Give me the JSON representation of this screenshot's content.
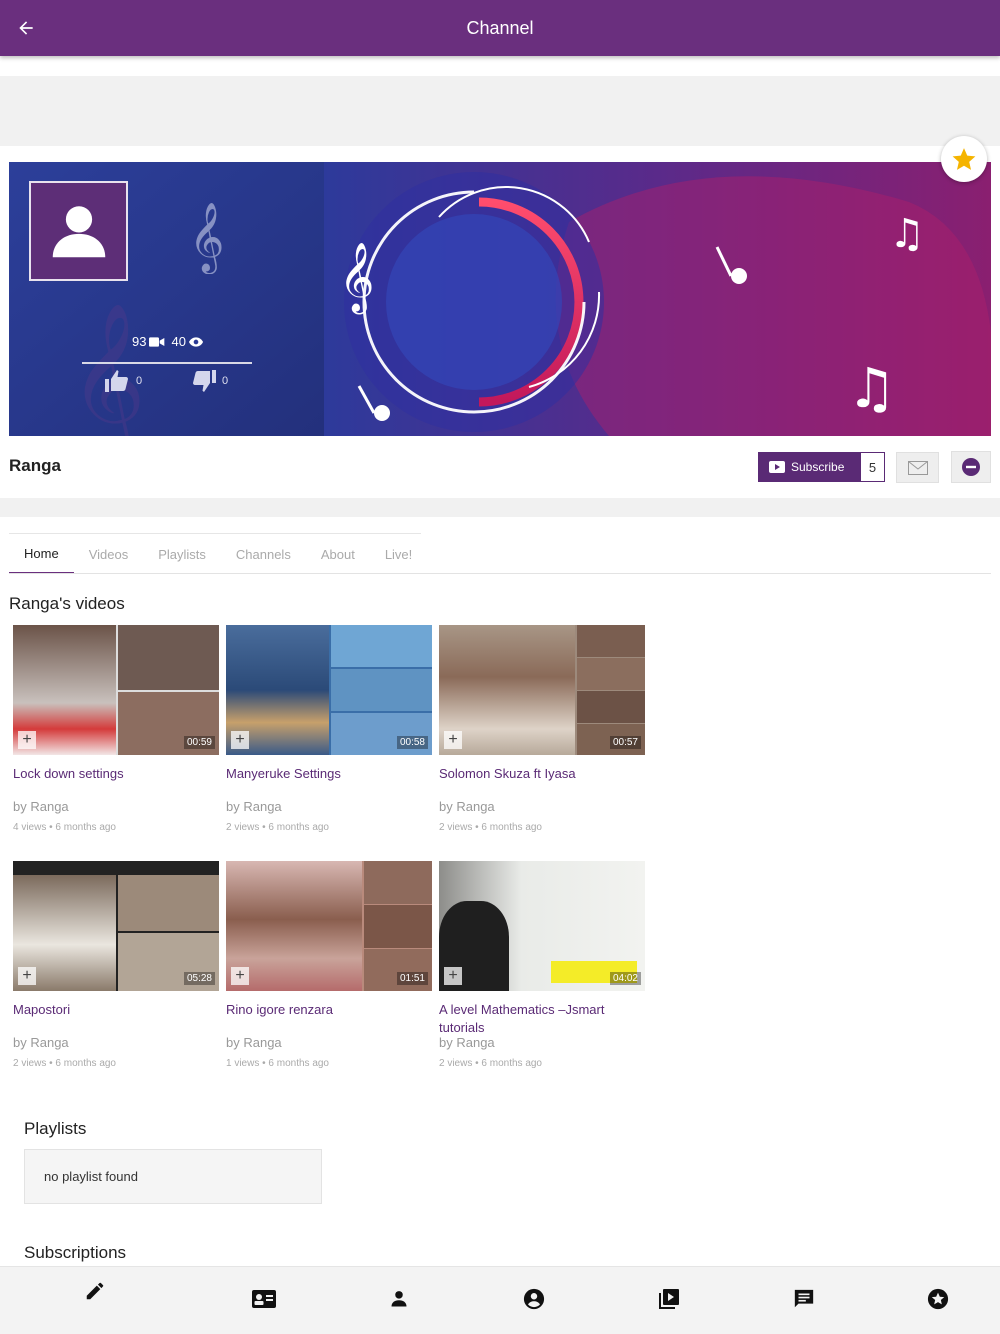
{
  "appbar": {
    "title": "Channel",
    "back_icon": "arrow-left-icon"
  },
  "channel": {
    "name": "Ranga",
    "video_count": "93",
    "view_count": "40",
    "likes": "0",
    "dislikes": "0",
    "subscribe_label": "Subscribe",
    "subscriber_count": "5"
  },
  "tabs": [
    {
      "label": "Home",
      "active": true
    },
    {
      "label": "Videos",
      "active": false
    },
    {
      "label": "Playlists",
      "active": false
    },
    {
      "label": "Channels",
      "active": false
    },
    {
      "label": "About",
      "active": false
    },
    {
      "label": "Live!",
      "active": false
    }
  ],
  "videos_section": {
    "title": "Ranga's videos"
  },
  "videos": [
    {
      "title": "Lock down settings",
      "by": "by Ranga",
      "meta": "4 views • 6 months ago",
      "duration": "00:59"
    },
    {
      "title": "Manyeruke Settings",
      "by": "by Ranga",
      "meta": "2 views • 6 months ago",
      "duration": "00:58"
    },
    {
      "title": "Solomon Skuza ft Iyasa",
      "by": "by Ranga",
      "meta": "2 views • 6 months ago",
      "duration": "00:57"
    },
    {
      "title": "Mapostori",
      "by": "by Ranga",
      "meta": "2 views • 6 months ago",
      "duration": "05:28"
    },
    {
      "title": "Rino igore renzara",
      "by": "by Ranga",
      "meta": "1 views • 6 months ago",
      "duration": "01:51"
    },
    {
      "title": "A level Mathematics –Jsmart tutorials",
      "by": "by Ranga",
      "meta": "2 views • 6 months ago",
      "duration": "04:02"
    }
  ],
  "playlists": {
    "title": "Playlists",
    "empty_text": "no playlist found"
  },
  "subscriptions": {
    "title": "Subscriptions"
  },
  "bottom_nav": [
    "edit-icon",
    "contact-card-icon",
    "person-icon",
    "account-circle-icon",
    "video-library-icon",
    "chat-icon",
    "star-circle-icon"
  ],
  "colors": {
    "brand": "#6a2f7e",
    "link": "#5a2a75",
    "star": "#f5b400"
  }
}
